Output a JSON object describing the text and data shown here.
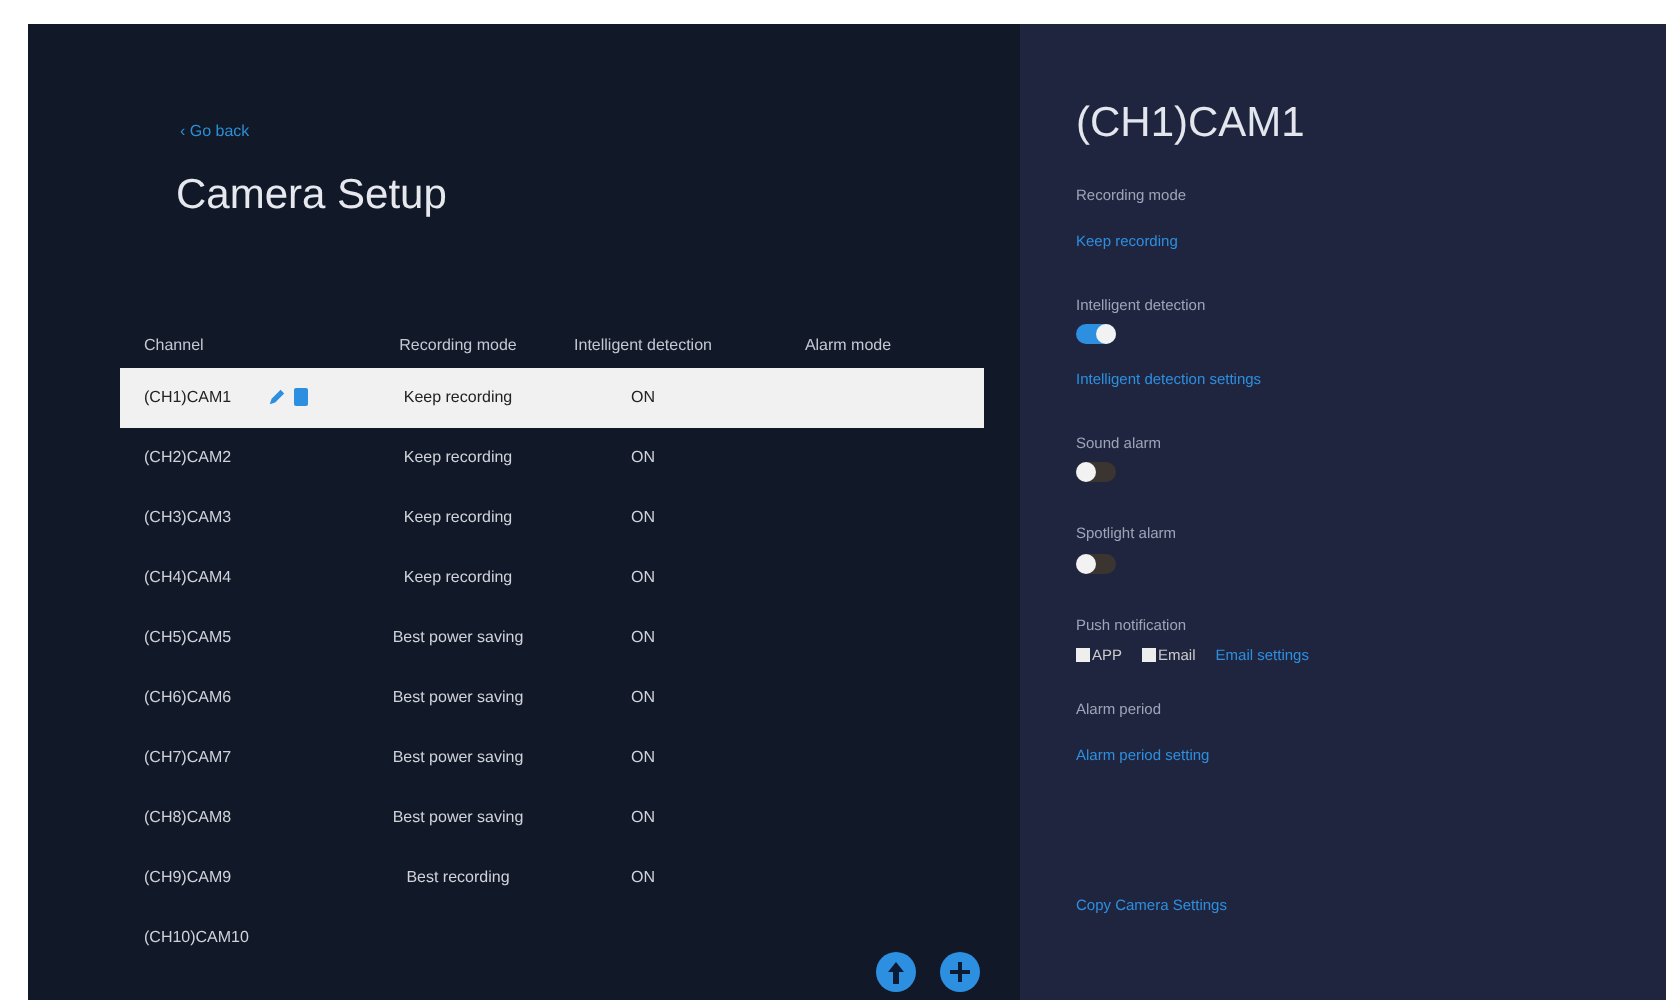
{
  "back_link": "‹ Go back",
  "title": "Camera Setup",
  "table": {
    "columns": [
      "Channel",
      "Recording mode",
      "Intelligent detection",
      "Alarm mode"
    ],
    "rows": [
      {
        "channel": "(CH1)CAM1",
        "recording_mode": "Keep recording",
        "detection": "ON",
        "selected": true
      },
      {
        "channel": "(CH2)CAM2",
        "recording_mode": "Keep recording",
        "detection": "ON",
        "selected": false
      },
      {
        "channel": "(CH3)CAM3",
        "recording_mode": "Keep recording",
        "detection": "ON",
        "selected": false
      },
      {
        "channel": "(CH4)CAM4",
        "recording_mode": "Keep recording",
        "detection": "ON",
        "selected": false
      },
      {
        "channel": "(CH5)CAM5",
        "recording_mode": "Best power saving",
        "detection": "ON",
        "selected": false
      },
      {
        "channel": "(CH6)CAM6",
        "recording_mode": "Best power saving",
        "detection": "ON",
        "selected": false
      },
      {
        "channel": "(CH7)CAM7",
        "recording_mode": "Best power saving",
        "detection": "ON",
        "selected": false
      },
      {
        "channel": "(CH8)CAM8",
        "recording_mode": "Best power saving",
        "detection": "ON",
        "selected": false
      },
      {
        "channel": "(CH9)CAM9",
        "recording_mode": "Best recording",
        "detection": "ON",
        "selected": false
      },
      {
        "channel": "(CH10)CAM10",
        "selected": false
      }
    ]
  },
  "detail": {
    "title": "(CH1)CAM1",
    "sections": [
      {
        "kind": "link",
        "label": "Recording mode",
        "link": "Keep recording"
      },
      {
        "kind": "toggle",
        "label": "Intelligent detection",
        "on": true,
        "link": "Intelligent detection settings"
      },
      {
        "kind": "toggle",
        "label": "Sound alarm",
        "on": false
      },
      {
        "kind": "toggle",
        "label": "Spotlight alarm",
        "on": false
      },
      {
        "kind": "checks",
        "label": "Push notification",
        "options": [
          {
            "label": "APP",
            "checked": false
          },
          {
            "label": "Email",
            "checked": false
          }
        ],
        "link": "Email settings"
      },
      {
        "kind": "link",
        "label": "Alarm period",
        "link": "Alarm period setting"
      }
    ],
    "footer_link": "Copy Camera Settings"
  }
}
